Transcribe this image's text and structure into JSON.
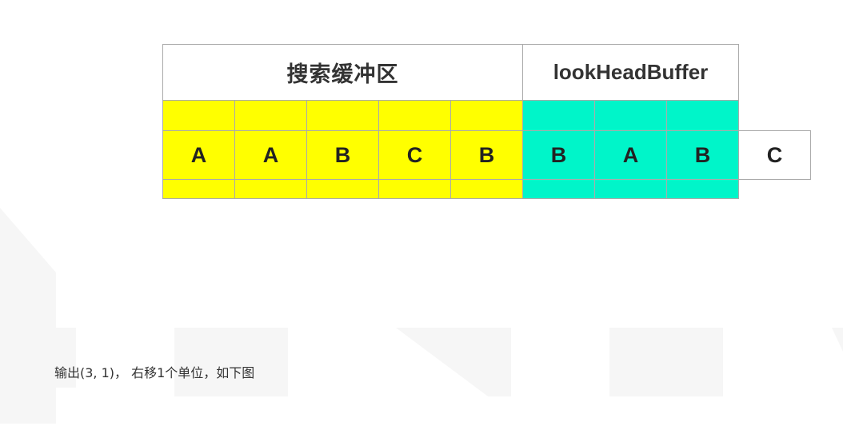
{
  "diagram": {
    "search_buffer_label": "搜索缓冲区",
    "lookahead_buffer_label": "lookHeadBuffer",
    "search_buffer_color": "#ffff00",
    "lookahead_buffer_color": "#00f5c9",
    "search_symbols": [
      "A",
      "A",
      "B",
      "C",
      "B"
    ],
    "lookahead_symbols": [
      "B",
      "A",
      "B"
    ],
    "next_symbol": "C"
  },
  "caption": "输出(3, 1)， 右移1个单位，如下图"
}
